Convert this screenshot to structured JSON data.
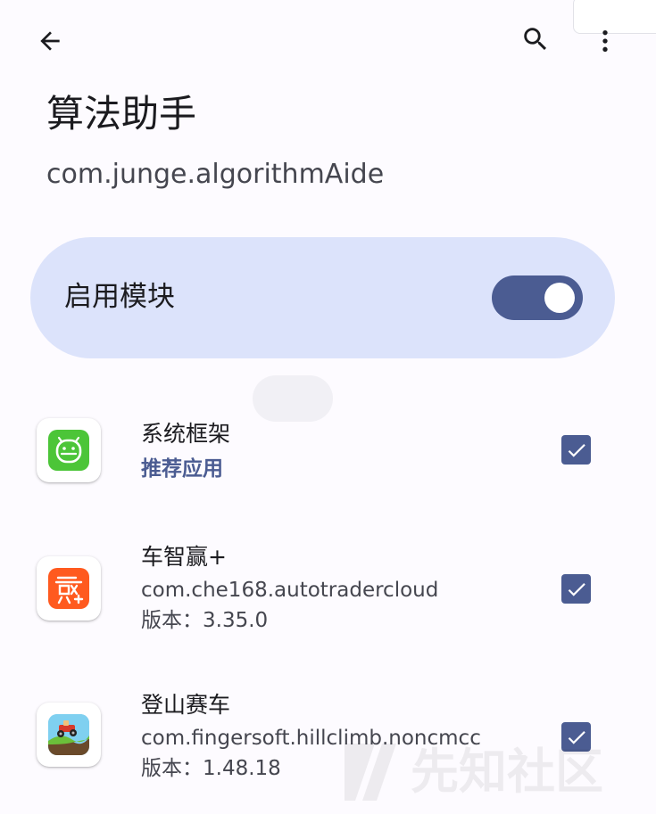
{
  "toolbar": {
    "back_icon": "arrow-back-icon",
    "search_icon": "search-icon",
    "more_icon": "more-vert-icon"
  },
  "header": {
    "title": "算法助手",
    "package": "com.junge.algorithmAide"
  },
  "module": {
    "label": "启用模块",
    "enabled": true,
    "accent_color": "#4b5c92",
    "card_color": "#dce3fb"
  },
  "apps": [
    {
      "name": "系统框架",
      "recommend": "推荐应用",
      "checked": true,
      "icon": "android-icon",
      "icon_color": "#4cc538"
    },
    {
      "name": "车智赢+",
      "package": "com.che168.autotradercloud",
      "version": "版本：3.35.0",
      "checked": true,
      "icon": "chezhiying-app-icon",
      "icon_color": "#ff5a1f"
    },
    {
      "name": "登山赛车",
      "package": "com.fingersoft.hillclimb.noncmcc",
      "version": "版本：1.48.18",
      "checked": true,
      "icon": "hill-climb-app-icon",
      "icon_color": "#6fc3e8"
    }
  ],
  "watermark": {
    "text": "先知社区"
  }
}
